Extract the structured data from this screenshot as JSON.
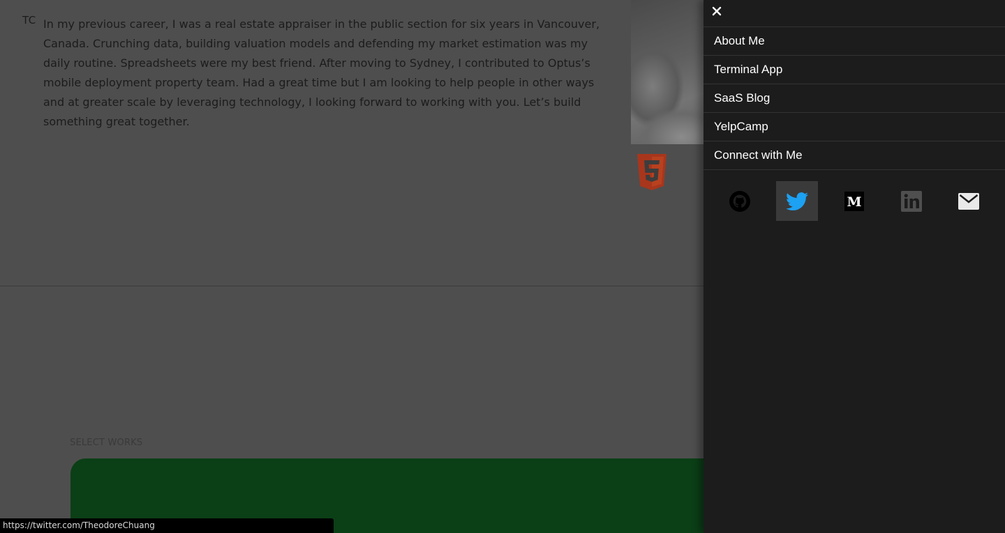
{
  "header": {
    "logo": "TC"
  },
  "about": {
    "bio": "In my previous career, I was a real estate appraiser in the public section for six years in Vancouver, Canada. Crunching data, building valuation models and defending my market estimation was my daily routine. Spreadsheets were my best friend. After moving to Sydney, I contributed to Optus’s mobile deployment property team. Had a great time but I am looking to help people in other ways and at greater scale by leveraging technology, I looking forward to working with you. Let’s build something great together."
  },
  "works": {
    "section_label": "SELECT WORKS"
  },
  "drawer": {
    "close_icon": "close-icon",
    "menu": [
      {
        "label": "About Me"
      },
      {
        "label": "Terminal App"
      },
      {
        "label": "SaaS Blog"
      },
      {
        "label": "YelpCamp"
      },
      {
        "label": "Connect with Me"
      }
    ],
    "social": [
      {
        "icon": "github-icon"
      },
      {
        "icon": "twitter-icon",
        "state": "hovered"
      },
      {
        "icon": "medium-icon"
      },
      {
        "icon": "linkedin-icon"
      },
      {
        "icon": "email-icon"
      }
    ]
  },
  "status_bar": {
    "url": "https://twitter.com/TheodoreChuang"
  },
  "colors": {
    "drawer_bg": "#1c1c1c",
    "twitter_blue": "#1da1f2",
    "html5_orange": "#a8361c",
    "work_card_green": "#0b3f16",
    "overlay_bg": "#4e4e4e"
  }
}
